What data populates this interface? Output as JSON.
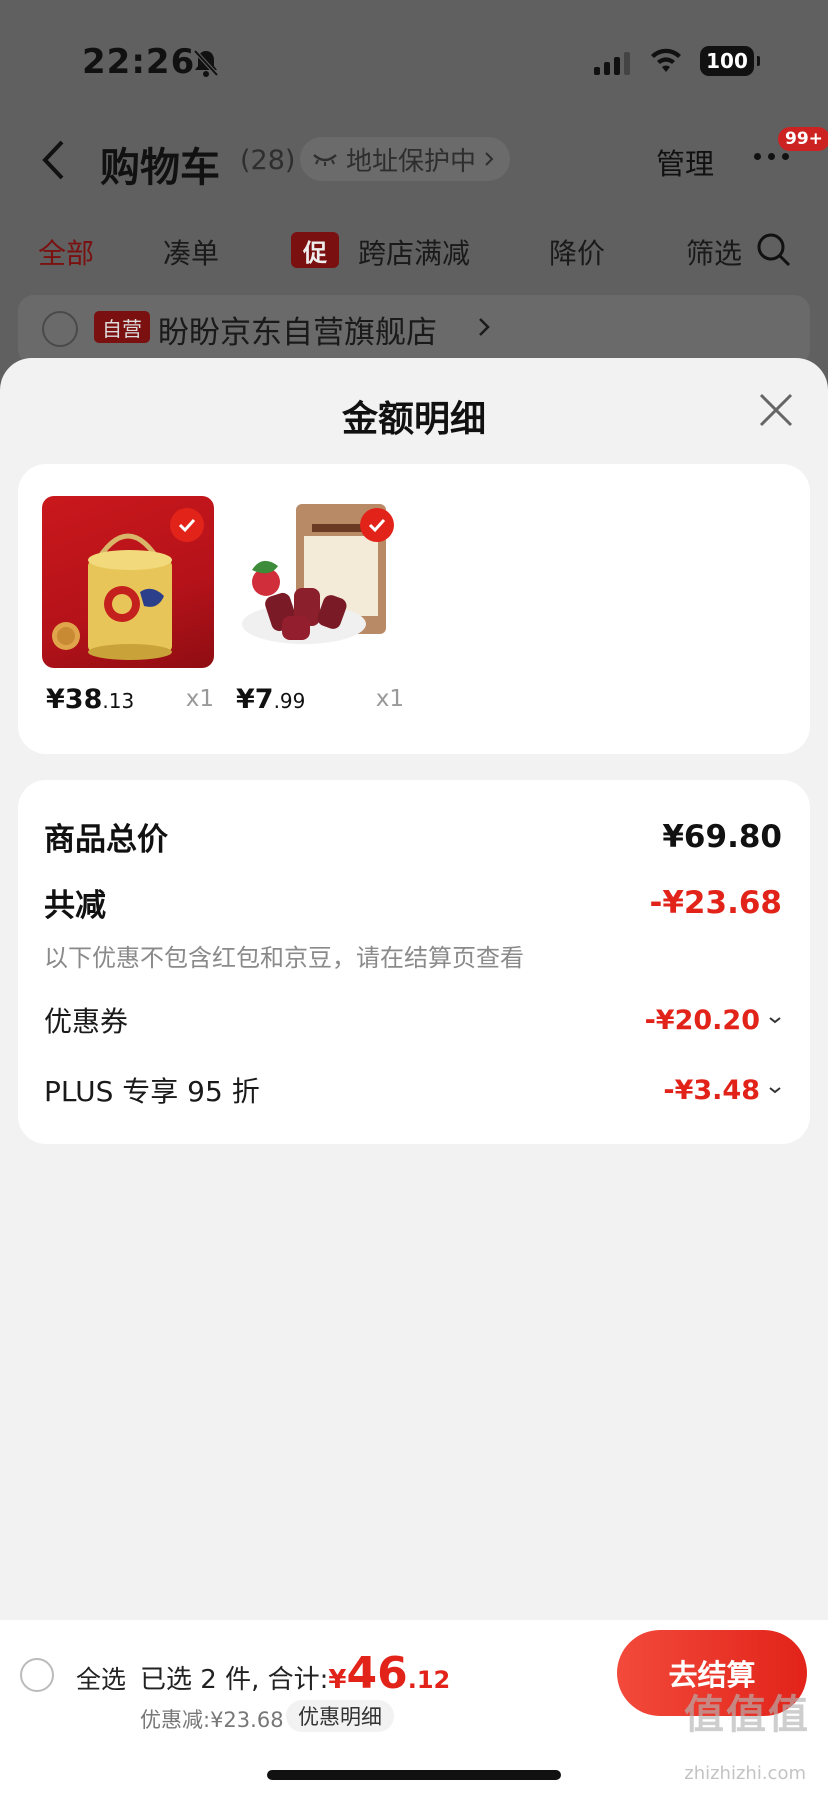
{
  "status_bar": {
    "time": "22:26",
    "battery": "100"
  },
  "nav": {
    "title": "购物车",
    "count": "(28)",
    "address_label": "地址保护中",
    "manage": "管理",
    "badge": "99+"
  },
  "tabs": [
    {
      "label": "全部"
    },
    {
      "label": "凑单"
    },
    {
      "label": "跨店满减",
      "tag": "促"
    },
    {
      "label": "降价"
    },
    {
      "label": "筛选"
    }
  ],
  "store": {
    "tag": "自营",
    "name": "盼盼京东自营旗舰店"
  },
  "sheet": {
    "title": "金额明细",
    "products": [
      {
        "price_int": "¥38",
        "price_dec": ".13",
        "qty": "x1"
      },
      {
        "price_int": "¥7",
        "price_dec": ".99",
        "qty": "x1"
      }
    ],
    "total_label": "商品总价",
    "total_value": "¥69.80",
    "discount_label": "共减",
    "discount_value": "-¥23.68",
    "discount_note": "以下优惠不包含红包和京豆，请在结算页查看",
    "coupon_label": "优惠券",
    "coupon_value": "-¥20.20",
    "plus_label": "PLUS 专享 95 折",
    "plus_value": "-¥3.48"
  },
  "footer": {
    "select_all": "全选",
    "selected_text": "已选 2 件, 合计:",
    "total_currency": "¥",
    "total_int": "46",
    "total_dec": ".12",
    "saved_text": "优惠减:¥23.68",
    "detail_button": "优惠明细",
    "checkout_button": "去结算"
  },
  "watermark": {
    "main": "值值值",
    "sub": "zhizhizhi.com"
  }
}
